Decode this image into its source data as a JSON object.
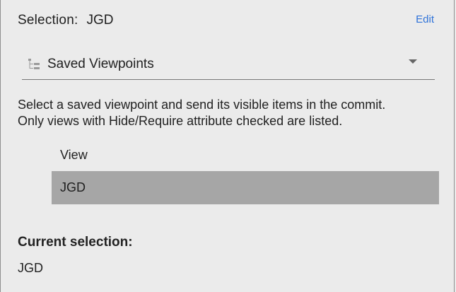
{
  "header": {
    "selection_label": "Selection:",
    "selection_value": "JGD",
    "edit_label": "Edit"
  },
  "dropdown": {
    "icon": "tree-list-icon",
    "selected_value": "Saved Viewpoints"
  },
  "description": {
    "line1": "Select a saved viewpoint and send its visible items in the commit.",
    "line2": "Only views with Hide/Require attribute checked are listed."
  },
  "viewpoints_list": {
    "column_header": "View",
    "rows": [
      "JGD"
    ]
  },
  "current_selection": {
    "label": "Current selection:",
    "value": "JGD"
  },
  "colors": {
    "background": "#ebebeb",
    "link": "#2f73d9",
    "selected_row": "#a6a6a6"
  }
}
